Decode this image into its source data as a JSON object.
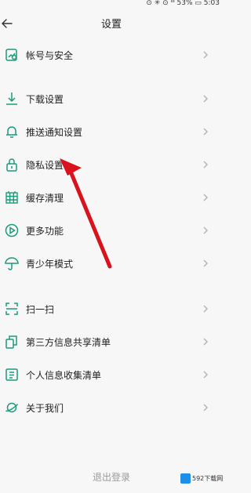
{
  "status_bar": {
    "text": "⊙ ✳ ⊙ ᑊᑊᑊ 53% ▭ 5:03"
  },
  "header": {
    "title": "设置"
  },
  "settings": [
    {
      "label": "帐号与安全",
      "icon": "account-security-icon"
    },
    {
      "label": "下载设置",
      "icon": "download-icon"
    },
    {
      "label": "推送通知设置",
      "icon": "bell-icon"
    },
    {
      "label": "隐私设置",
      "icon": "lock-icon"
    },
    {
      "label": "缓存清理",
      "icon": "cache-grid-icon"
    },
    {
      "label": "更多功能",
      "icon": "play-circle-icon"
    },
    {
      "label": "青少年模式",
      "icon": "umbrella-icon"
    },
    {
      "label": "扫一扫",
      "icon": "scan-icon"
    },
    {
      "label": "第三方信息共享清单",
      "icon": "share-list-icon"
    },
    {
      "label": "个人信息收集清单",
      "icon": "personal-info-icon"
    },
    {
      "label": "关于我们",
      "icon": "planet-icon"
    }
  ],
  "footer": {
    "logout_label": "退出登录"
  },
  "watermark": {
    "text": "592下载网"
  },
  "colors": {
    "icon": "#1d9a7c",
    "chevron": "#b5b5b5",
    "annotation_arrow": "#d8131d"
  }
}
